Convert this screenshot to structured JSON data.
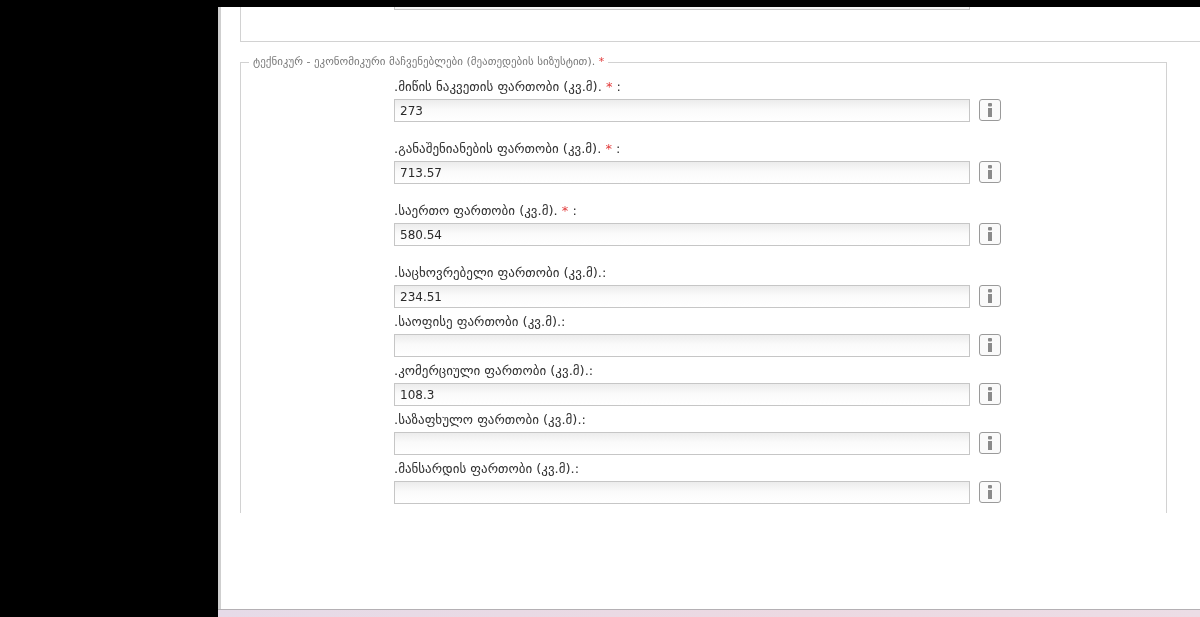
{
  "fieldset": {
    "legend": "ტექნიკურ - ეკონომიკური მაჩვენებლები (მეათედების სიზუსტით).",
    "legend_mark": "*",
    "fields": [
      {
        "label": ".მიწის ნაკვეთის ფართობი (კვ.მ).",
        "mark": "*",
        "suffix": ":",
        "value": "273"
      },
      {
        "label": ".განაშენიანების ფართობი (კვ.მ).",
        "mark": "*",
        "suffix": ":",
        "value": "713.57"
      },
      {
        "label": ".საერთო ფართობი (კვ.მ).",
        "mark": "*",
        "suffix": ":",
        "value": "580.54"
      },
      {
        "label": ".საცხოვრებელი ფართობი (კვ.მ).:",
        "value": "234.51"
      },
      {
        "label": ".საოფისე ფართობი (კვ.მ).:"
      },
      {
        "label": ".კომერციული ფართობი (კვ.მ).:",
        "value": "108.3"
      },
      {
        "label": ".საზაფხულო ფართობი (კვ.მ).:"
      },
      {
        "label": ".მანსარდის ფართობი (კვ.მ).:"
      }
    ]
  }
}
